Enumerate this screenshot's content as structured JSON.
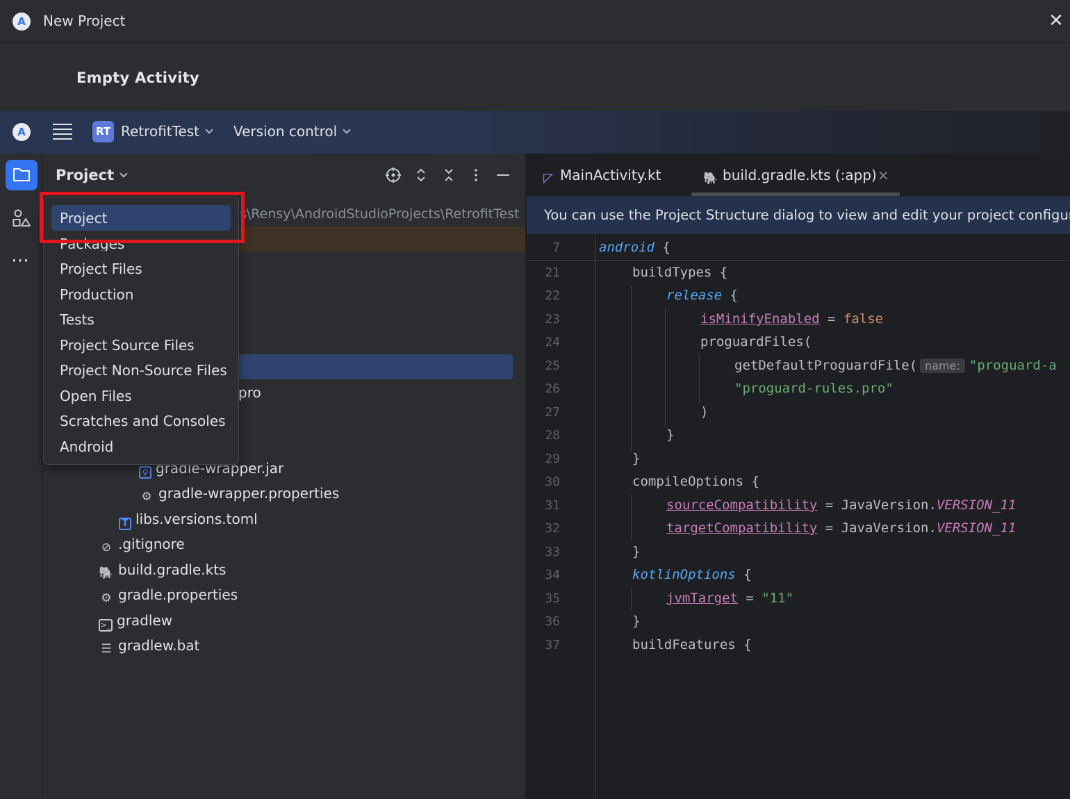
{
  "dialog": {
    "title": "New Project",
    "close_glyph": "✕",
    "activity_label": "Empty Activity"
  },
  "toolbar": {
    "project_badge": "RT",
    "project_name": "RetrofitTest",
    "version_control": "Version control"
  },
  "tool_stripe": {
    "more_glyph": "⋯"
  },
  "project_panel": {
    "title": "Project",
    "path_fragment": "s\\Rensy\\AndroidStudioProjects\\RetrofitTest",
    "partial_pro": "pro",
    "tree": [
      {
        "label": "gradle-wrapper.jar",
        "icon": "jar-icon"
      },
      {
        "label": "gradle-wrapper.properties",
        "icon": "gear-icon"
      },
      {
        "label": "libs.versions.toml",
        "icon": "toml-icon"
      },
      {
        "label": ".gitignore",
        "icon": "ignore-icon"
      },
      {
        "label": "build.gradle.kts",
        "icon": "gradle-icon"
      },
      {
        "label": "gradle.properties",
        "icon": "gear-icon"
      },
      {
        "label": "gradlew",
        "icon": "terminal-icon"
      },
      {
        "label": "gradlew.bat",
        "icon": "text-lines-icon"
      }
    ]
  },
  "view_dropdown": {
    "items": [
      "Project",
      "Packages",
      "Project Files",
      "Production",
      "Tests",
      "Project Source Files",
      "Project Non-Source Files",
      "Open Files",
      "Scratches and Consoles",
      "Android"
    ],
    "selected": "Project"
  },
  "editor": {
    "tabs": [
      {
        "label": "MainActivity.kt"
      },
      {
        "label": "build.gradle.kts (:app)",
        "close": "×"
      }
    ],
    "banner": "You can use the Project Structure dialog to view and edit your project configurat",
    "sticky": {
      "line": "7",
      "keyword": "android",
      "brace": " {"
    },
    "line_numbers": [
      "21",
      "22",
      "23",
      "24",
      "25",
      "26",
      "27",
      "28",
      "29",
      "30",
      "31",
      "32",
      "33",
      "34",
      "35",
      "36",
      "37"
    ],
    "code": {
      "l21": "buildTypes {",
      "l22_kw": "release",
      "l22_rest": " {",
      "l23_prop": "isMinifyEnabled",
      "l23_eq": " = ",
      "l23_val": "false",
      "l24": "proguardFiles(",
      "l25_fn": "getDefaultProguardFile(",
      "l25_hint": "name:",
      "l25_str": "\"proguard-a",
      "l26_str": "\"proguard-rules.pro\"",
      "l27": ")",
      "l28": "}",
      "l29": "}",
      "l30": "compileOptions {",
      "l31_prop": "sourceCompatibility",
      "l31_eq": " = JavaVersion.",
      "l31_const": "VERSION_11",
      "l32_prop": "targetCompatibility",
      "l32_eq": " = JavaVersion.",
      "l32_const": "VERSION_11",
      "l33": "}",
      "l34_kw": "kotlinOptions",
      "l34_rest": " {",
      "l35_prop": "jvmTarget",
      "l35_eq": " = ",
      "l35_str": "\"11\"",
      "l36": "}",
      "l37": "buildFeatures {"
    }
  },
  "colors": {
    "accent": "#3574f0",
    "highlight_box": "#e3141d",
    "selection": "#2e436e"
  }
}
